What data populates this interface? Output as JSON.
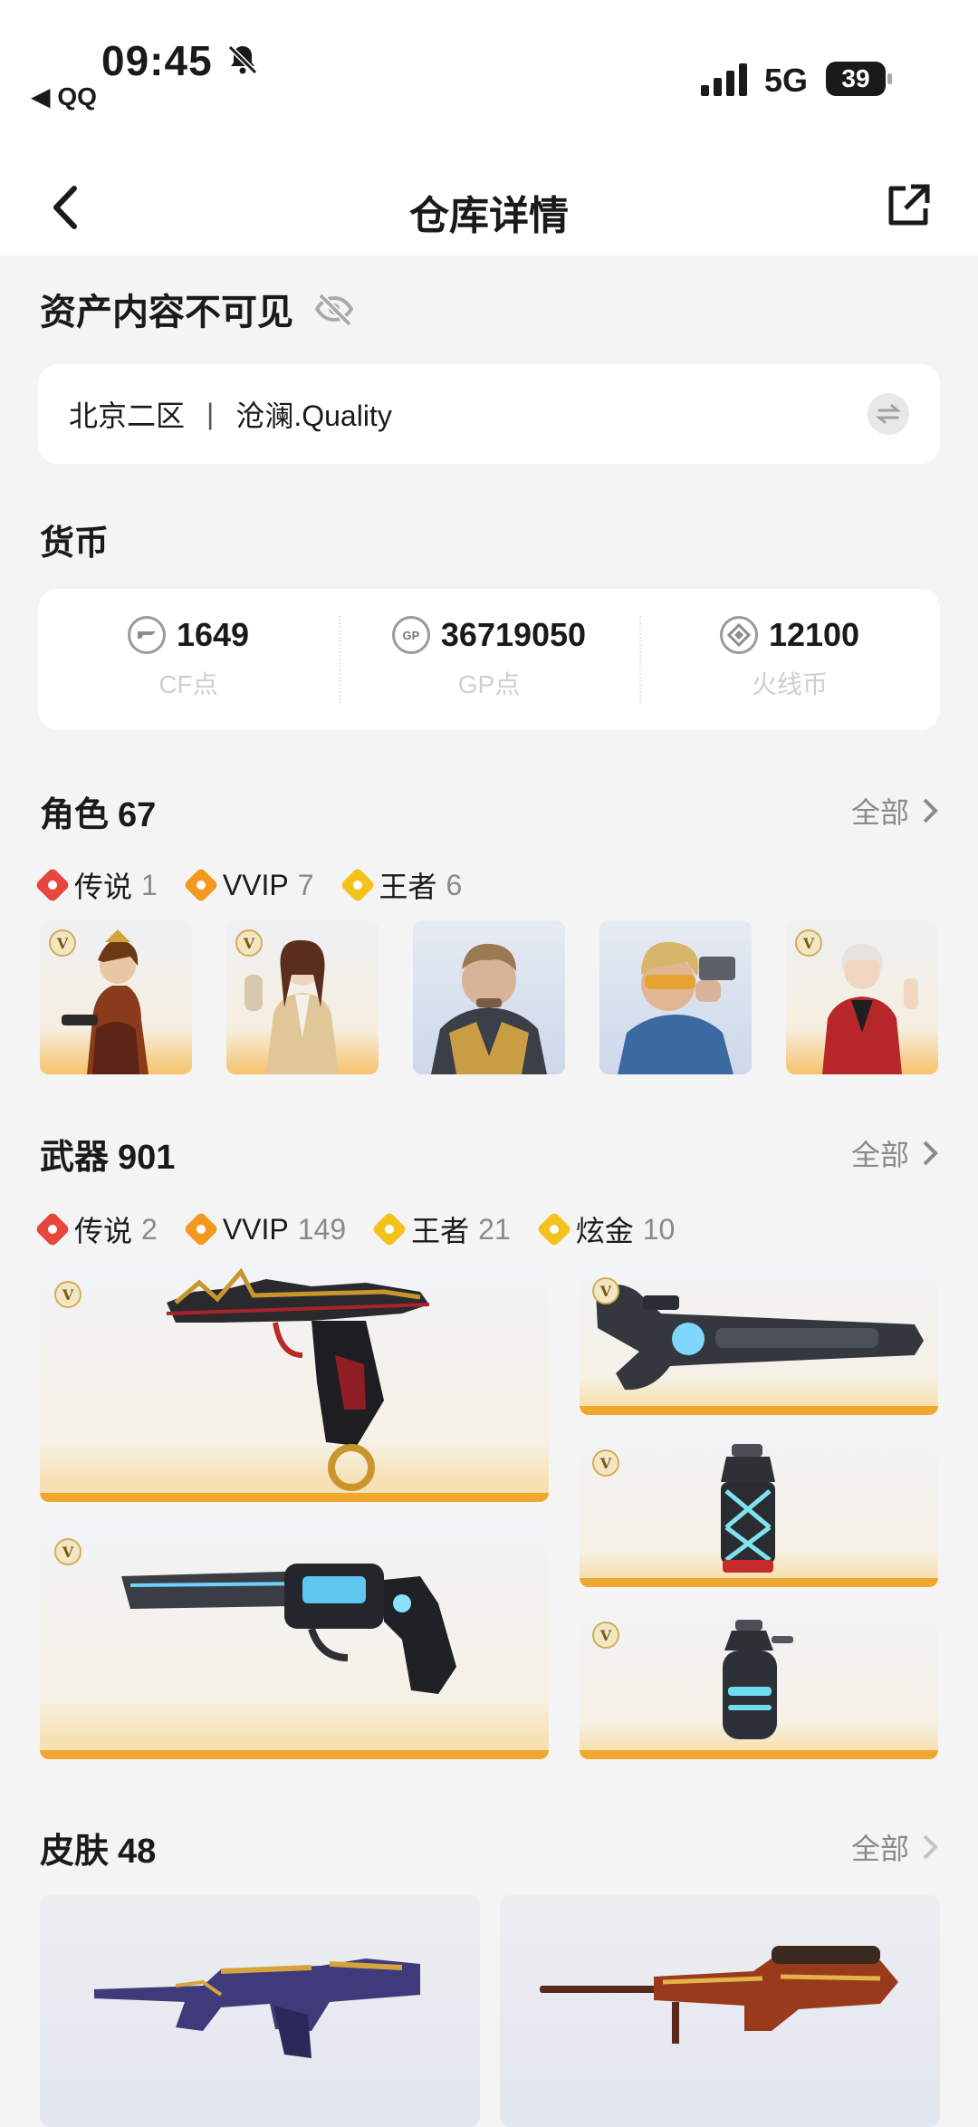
{
  "status": {
    "time": "09:45",
    "back_app": "◀ QQ",
    "network": "5G",
    "battery": "39"
  },
  "nav": {
    "title": "仓库详情"
  },
  "privacy": {
    "label": "资产内容不可见"
  },
  "server": {
    "region": "北京二区",
    "separator": "|",
    "name": "沧澜.Quality"
  },
  "currency": {
    "title": "货币",
    "items": [
      {
        "icon": "cf-point-icon",
        "value": "1649",
        "name": "CF点"
      },
      {
        "icon": "gp-point-icon",
        "value": "36719050",
        "name": "GP点"
      },
      {
        "icon": "firewire-coin-icon",
        "value": "12100",
        "name": "火线币"
      }
    ]
  },
  "roles": {
    "title": "角色",
    "count": "67",
    "all_label": "全部",
    "tags": [
      {
        "label": "传说",
        "count": "1",
        "color": "#e8453c"
      },
      {
        "label": "VVIP",
        "count": "7",
        "color": "#f39a1e"
      },
      {
        "label": "王者",
        "count": "6",
        "color": "#f5c21b"
      }
    ]
  },
  "weapons": {
    "title": "武器",
    "count": "901",
    "all_label": "全部",
    "tags": [
      {
        "label": "传说",
        "count": "2",
        "color": "#e8453c"
      },
      {
        "label": "VVIP",
        "count": "149",
        "color": "#f39a1e"
      },
      {
        "label": "王者",
        "count": "21",
        "color": "#f5c21b"
      },
      {
        "label": "炫金",
        "count": "10",
        "color": "#f5c21b"
      }
    ]
  },
  "skins": {
    "title": "皮肤",
    "count": "48",
    "all_label": "全部"
  },
  "badge_letter": "V",
  "colors": {
    "legend": "#e8453c",
    "vvip": "#f39a1e",
    "king": "#f5c21b",
    "rarity_bar": "#f0a730"
  }
}
